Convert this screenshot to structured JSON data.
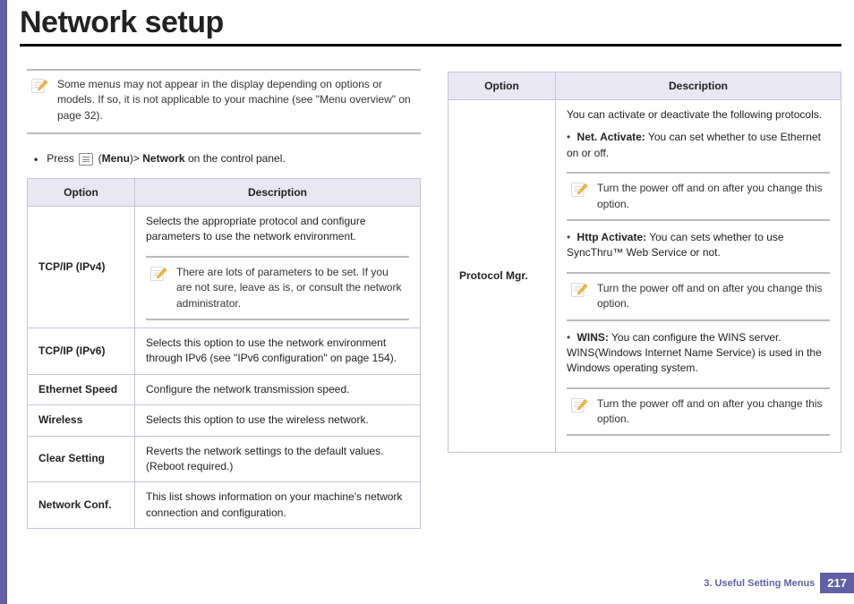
{
  "title": "Network setup",
  "top_note": "Some menus may not appear in the display depending on options or models. If so, it is not applicable to your machine (see \"Menu overview\" on page 32).",
  "instruction": {
    "prefix": "Press",
    "menu_label": "Menu",
    "path": "Network",
    "suffix": "on the control panel."
  },
  "table_headers": {
    "option": "Option",
    "description": "Description"
  },
  "left_rows": [
    {
      "option": "TCP/IP (IPv4)",
      "desc": "Selects the appropriate protocol and configure parameters to use the network environment.",
      "note": "There are lots of parameters to be set. If you are not sure, leave as is, or consult the network administrator."
    },
    {
      "option": "TCP/IP (IPv6)",
      "desc": "Selects this option to use the network environment through IPv6 (see \"IPv6 configuration\" on page 154)."
    },
    {
      "option": "Ethernet Speed",
      "desc": "Configure the network transmission speed."
    },
    {
      "option": "Wireless",
      "desc": "Selects this option to use the wireless network."
    },
    {
      "option": "Clear Setting",
      "desc": "Reverts the network settings to the default values. (Reboot required.)"
    },
    {
      "option": "Network Conf.",
      "desc": "This list shows information on your machine's network connection and configuration."
    }
  ],
  "right_row": {
    "option": "Protocol Mgr.",
    "intro": "You can activate or deactivate the following protocols.",
    "items": [
      {
        "label": "Net. Activate:",
        "text": "You can set whether to use Ethernet on or off.",
        "note": "Turn the power off and on after you change this option."
      },
      {
        "label": "Http Activate:",
        "text": "You can sets whether to use SyncThru™ Web Service or not.",
        "note": "Turn the power off and on after you change this option."
      },
      {
        "label": "WINS:",
        "text": " You can configure the WINS server. WINS(Windows Internet Name Service) is used in the Windows operating system.",
        "note": "Turn the power off and on after you change this option."
      }
    ]
  },
  "footer": {
    "section": "3.  Useful Setting Menus",
    "page": "217"
  }
}
